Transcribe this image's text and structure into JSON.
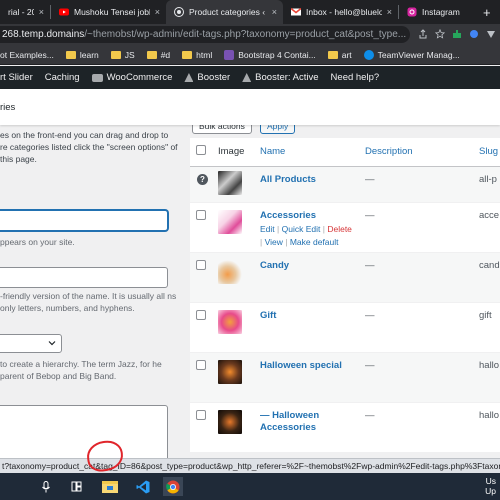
{
  "browser": {
    "tabs": [
      {
        "title": "rial - 20",
        "favicon": "generic-tab-icon",
        "active": false
      },
      {
        "title": "Mushoku Tensei joble",
        "favicon": "youtube-icon",
        "active": false
      },
      {
        "title": "Product categories ‹ T",
        "favicon": "wordpress-icon",
        "active": true
      },
      {
        "title": "Inbox - hello@bluelo",
        "favicon": "gmail-icon",
        "active": false
      },
      {
        "title": "Instagram",
        "favicon": "instagram-icon",
        "active": false
      }
    ],
    "new_tab_symbol": "+",
    "close_symbol": "×",
    "url_host": "268.temp.domains",
    "url_path": "/~themobst/wp-admin/edit-tags.php?taxonomy=product_cat&post_type...",
    "bookmarks": [
      {
        "label": "ot Examples...",
        "icon": "doc-icon"
      },
      {
        "label": "learn",
        "icon": "folder-icon"
      },
      {
        "label": "JS",
        "icon": "folder-icon"
      },
      {
        "label": "#d",
        "icon": "folder-icon"
      },
      {
        "label": "html",
        "icon": "folder-icon"
      },
      {
        "label": "Bootstrap 4 Contai...",
        "icon": "bootstrap-icon"
      },
      {
        "label": "art",
        "icon": "folder-icon"
      },
      {
        "label": "TeamViewer Manag...",
        "icon": "teamviewer-icon"
      }
    ]
  },
  "adminbar": {
    "items": [
      {
        "label": "rt Slider"
      },
      {
        "label": "Caching"
      },
      {
        "label": "WooCommerce",
        "icon": "woo-icon"
      },
      {
        "label": "Booster",
        "icon": "booster-icon"
      },
      {
        "label": "Booster: Active",
        "icon": "booster-icon"
      },
      {
        "label": "Need help?"
      }
    ]
  },
  "page": {
    "title": "ries"
  },
  "form": {
    "intro": "es on the front-end you can drag and drop to re categories listed click the \"screen options\" of this page.",
    "name_hint": "ppears on your site.",
    "slug_hint": "-friendly version of the name. It is usually all ns only letters, numbers, and hyphens.",
    "parent_hint": "to create a hierarchy. The term Jazz, for he parent of Bebop and Big Band."
  },
  "table": {
    "bulk_label": "Bulk actions",
    "apply_label": "Apply",
    "headers": {
      "image": "Image",
      "name": "Name",
      "description": "Description",
      "slug": "Slug"
    },
    "rows": [
      {
        "name": "All Products",
        "description": "—",
        "slug": "all-p",
        "has_checkbox": false,
        "actions": null
      },
      {
        "name": "Accessories",
        "description": "—",
        "slug": "acce",
        "has_checkbox": true,
        "actions": {
          "edit": "Edit",
          "quick_edit": "Quick Edit",
          "delete": "Delete",
          "view": "View",
          "make_default": "Make default"
        }
      },
      {
        "name": "Candy",
        "description": "—",
        "slug": "cand",
        "has_checkbox": true,
        "actions": null
      },
      {
        "name": "Gift",
        "description": "—",
        "slug": "gift",
        "has_checkbox": true,
        "actions": null
      },
      {
        "name": "Halloween special",
        "description": "—",
        "slug": "hallo",
        "has_checkbox": true,
        "actions": null
      },
      {
        "name": "— Halloween Accessories",
        "description": "—",
        "slug": "hallo",
        "has_checkbox": true,
        "actions": null
      }
    ]
  },
  "statusbar": {
    "url": "t?taxonomy=product_cat&tag_ID=86&post_type=product&wp_http_referer=%2F~themobst%2Fwp-admin%2Fedit-tags.php%3Ftaxonomy%3Dp"
  },
  "taskbar": {
    "clock_line1": "Us",
    "clock_line2": "Up"
  },
  "colors": {
    "wp_link": "#2271b1",
    "wp_delete": "#d63638",
    "admin_bar": "#1d2327",
    "annotation": "#e0252b"
  }
}
